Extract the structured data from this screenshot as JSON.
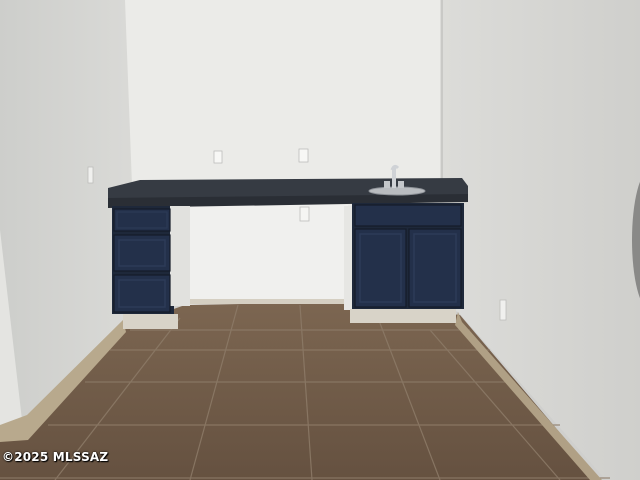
{
  "photo": {
    "watermark": "©2025 MLSSAZ",
    "colors": {
      "back_wall": "#e9e9e6",
      "left_wall": "#d6d7d4",
      "right_wall": "#d9d9d6",
      "floor": "#6f5a46",
      "grout": "#8b7a67",
      "countertop": "#3a3f47",
      "cabinet": "#1f2a3d",
      "baseboard": "#b9a98e"
    },
    "icons": [
      "faucet-icon",
      "sink-basin",
      "outlet-icon"
    ]
  }
}
